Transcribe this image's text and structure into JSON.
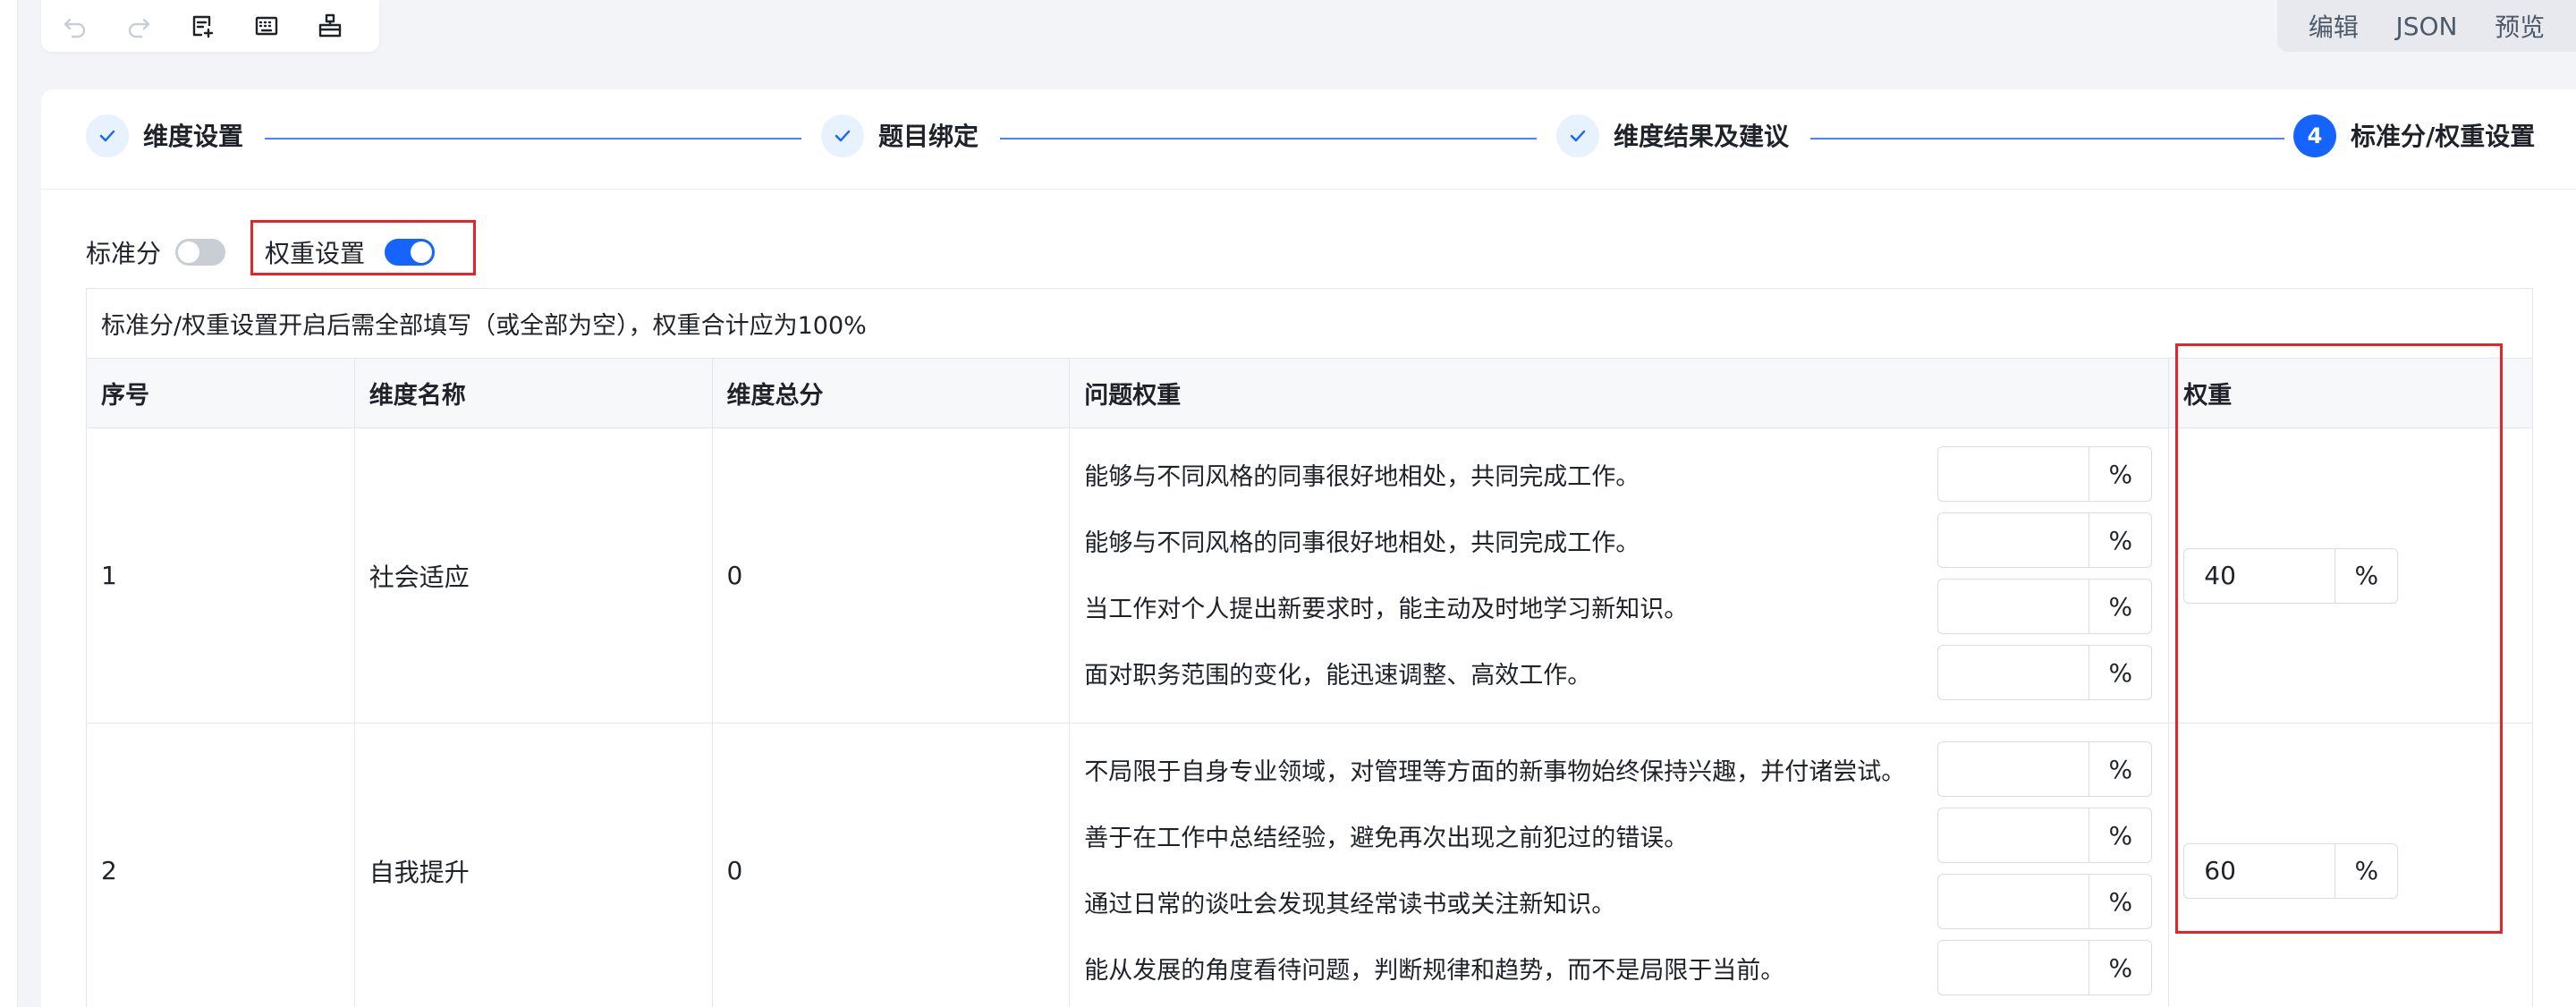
{
  "modes": [
    "编辑",
    "JSON",
    "预览"
  ],
  "toolbar": {
    "icons": [
      "undo-icon",
      "redo-icon",
      "add-doc-icon",
      "keyboard-icon",
      "hierarchy-icon"
    ]
  },
  "steps": [
    {
      "label": "维度设置",
      "status": "done"
    },
    {
      "label": "题目绑定",
      "status": "done"
    },
    {
      "label": "维度结果及建议",
      "status": "done"
    },
    {
      "label": "标准分/权重设置",
      "status": "active",
      "number": "4"
    }
  ],
  "toggles": {
    "standard_label": "标准分",
    "standard_on": false,
    "weight_label": "权重设置",
    "weight_on": true
  },
  "table": {
    "notice": "标准分/权重设置开启后需全部填写（或全部为空），权重合计应为100%",
    "headers": [
      "序号",
      "维度名称",
      "维度总分",
      "问题权重",
      "权重"
    ],
    "unit": "%",
    "rows": [
      {
        "index": "1",
        "name": "社会适应",
        "total": "0",
        "weight": "40",
        "questions": [
          {
            "text": "能够与不同风格的同事很好地相处，共同完成工作。",
            "value": ""
          },
          {
            "text": "能够与不同风格的同事很好地相处，共同完成工作。",
            "value": ""
          },
          {
            "text": "当工作对个人提出新要求时，能主动及时地学习新知识。",
            "value": ""
          },
          {
            "text": "面对职务范围的变化，能迅速调整、高效工作。",
            "value": ""
          }
        ]
      },
      {
        "index": "2",
        "name": "自我提升",
        "total": "0",
        "weight": "60",
        "questions": [
          {
            "text": "不局限于自身专业领域，对管理等方面的新事物始终保持兴趣，并付诸尝试。",
            "value": ""
          },
          {
            "text": "善于在工作中总结经验，避免再次出现之前犯过的错误。",
            "value": ""
          },
          {
            "text": "通过日常的谈吐会发现其经常读书或关注新知识。",
            "value": ""
          },
          {
            "text": "能从发展的角度看待问题，判断规律和趋势，而不是局限于当前。",
            "value": ""
          }
        ]
      }
    ]
  }
}
